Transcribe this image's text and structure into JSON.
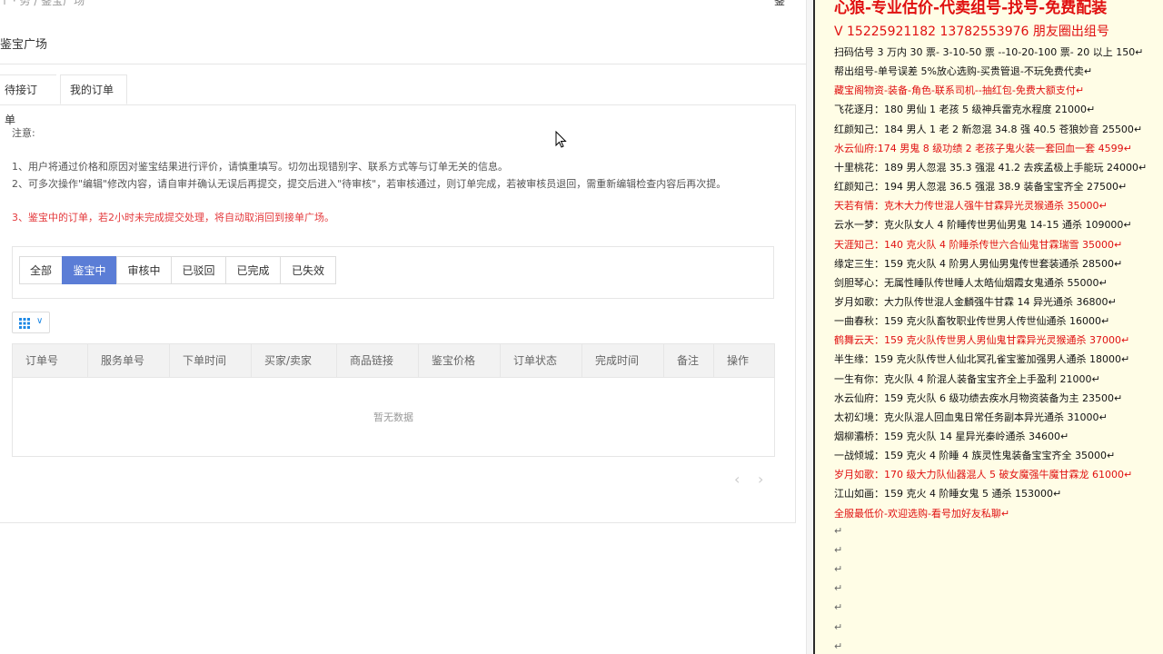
{
  "app": {
    "breadcrumb": "↑ · 务 / 鉴宝广场",
    "top_right": "鉴",
    "page_title": "鉴宝广场"
  },
  "tabs": [
    {
      "label": "待接订单"
    },
    {
      "label": "我的订单"
    }
  ],
  "notes": {
    "title": "注意:",
    "item1": "1、用户将通过价格和原因对鉴宝结果进行评价，请慎重填写。切勿出现错别字、联系方式等与订单无关的信息。",
    "item2": "2、可多次操作\"编辑\"修改内容，请自审并确认无误后再提交，提交后进入\"待审核\"，若审核通过，则订单完成，若被审核员退回，需重新编辑检查内容后再次提。",
    "item3": "3、鉴宝中的订单，若2小时未完成提交处理，将自动取消回到接单广场。"
  },
  "filters": [
    {
      "label": "全部"
    },
    {
      "label": "鉴宝中"
    },
    {
      "label": "审核中"
    },
    {
      "label": "已驳回"
    },
    {
      "label": "已完成"
    },
    {
      "label": "已失效"
    }
  ],
  "table": {
    "columns": [
      "订单号",
      "服务单号",
      "下单时间",
      "买家/卖家",
      "商品链接",
      "鉴宝价格",
      "订单状态",
      "完成时间",
      "备注",
      "操作"
    ],
    "empty_text": "暂无数据"
  },
  "pager": {
    "prev": "‹",
    "next": "›"
  },
  "doc": {
    "title": "心狼-专业估价-代卖组号-找号-免费配装",
    "phone": "V 15225921182   13782553976 朋友圈出组号",
    "lines": [
      {
        "text": "扫码估号 3 万内 30 票- 3-10-50 票  --10-20-100 票- 20 以上 150↵",
        "color": "black"
      },
      {
        "text": "帮出组号-单号误差 5%放心选购-买贵管退-不玩免费代卖↵",
        "color": "black"
      },
      {
        "text": "藏宝阁物资-装备-角色-联系司机--抽红包-免费大额支付↵",
        "color": "red"
      },
      {
        "text": "飞花逐月：180 男仙 1 老孩 5 级神兵雷克水程度 21000↵",
        "color": "black"
      },
      {
        "text": "红颜知己：184 男人 1 老 2 新忽混 34.8 强 40.5 苍狼妙音 25500↵",
        "color": "black"
      },
      {
        "text": "水云仙府:174 男鬼 8 级功绩 2 老孩子鬼火装一套回血一套 4599↵",
        "color": "red"
      },
      {
        "text": "十里桃花：189 男人忽混 35.3 强混 41.2 去疾孟极上手能玩 24000↵",
        "color": "black"
      },
      {
        "text": "红颜知己：194 男人忽混 36.5 强混 38.9 装备宝宝齐全 27500↵",
        "color": "black"
      },
      {
        "text": "天若有情：克木大力传世混人强牛甘霖异光灵猴通杀 35000↵",
        "color": "red"
      },
      {
        "text": "云水一梦：克火队女人 4 阶睡传世男仙男鬼 14-15 通杀 109000↵",
        "color": "black"
      },
      {
        "text": "天涯知己：140 克火队 4 阶睡杀传世六合仙鬼甘霖瑞雪 35000↵",
        "color": "red"
      },
      {
        "text": "缘定三生：159 克火队 4 阶男人男仙男鬼传世套装通杀 28500↵",
        "color": "black"
      },
      {
        "text": "剑胆琴心：无属性睡队传世睡人太皓仙烟霞女鬼通杀 55000↵",
        "color": "black"
      },
      {
        "text": "岁月如歌：大力队传世混人金麟强牛甘霖 14 异光通杀 36800↵",
        "color": "black"
      },
      {
        "text": "一曲春秋：159 克火队畜牧职业传世男人传世仙通杀 16000↵",
        "color": "black"
      },
      {
        "text": "鹤舞云天：159 克火队传世男人男仙鬼甘霖异光灵猴通杀 37000↵",
        "color": "red"
      },
      {
        "text": "半生缘：159 克火队传世人仙北冥孔雀宝鉴加强男人通杀 18000↵",
        "color": "black"
      },
      {
        "text": "一生有你：克火队 4 阶混人装备宝宝齐全上手盈利 21000↵",
        "color": "black"
      },
      {
        "text": "水云仙府：159 克火队 6 级功绩去疾水月物资装备为主 23500↵",
        "color": "black"
      },
      {
        "text": "太初幻境：克火队混人回血鬼日常任务副本异光通杀 31000↵",
        "color": "black"
      },
      {
        "text": "烟柳灞桥：159 克火队 14 星异光秦岭通杀 34600↵",
        "color": "black"
      },
      {
        "text": "一战倾城：159 克火 4 阶睡 4 族灵性鬼装备宝宝齐全 35000↵",
        "color": "black"
      },
      {
        "text": "岁月如歌：170 级大力队仙器混人 5 破女魔强牛魔甘霖龙 61000↵",
        "color": "red"
      },
      {
        "text": "江山如画：159 克火 4 阶睡女鬼 5 通杀 153000↵",
        "color": "black"
      },
      {
        "text": "全服最低价-欢迎选购-看号加好友私聊↵",
        "color": "red"
      },
      {
        "text": "↵",
        "color": "grey"
      },
      {
        "text": "↵",
        "color": "grey"
      },
      {
        "text": "↵",
        "color": "grey"
      },
      {
        "text": "↵",
        "color": "grey"
      },
      {
        "text": "↵",
        "color": "grey"
      },
      {
        "text": "↵",
        "color": "grey"
      },
      {
        "text": "↵",
        "color": "grey"
      }
    ]
  },
  "colors": {
    "accent": "#5b7dd6",
    "warning_red": "#e4393c",
    "doc_red": "#e01010",
    "doc_bg": "#fffde6"
  }
}
